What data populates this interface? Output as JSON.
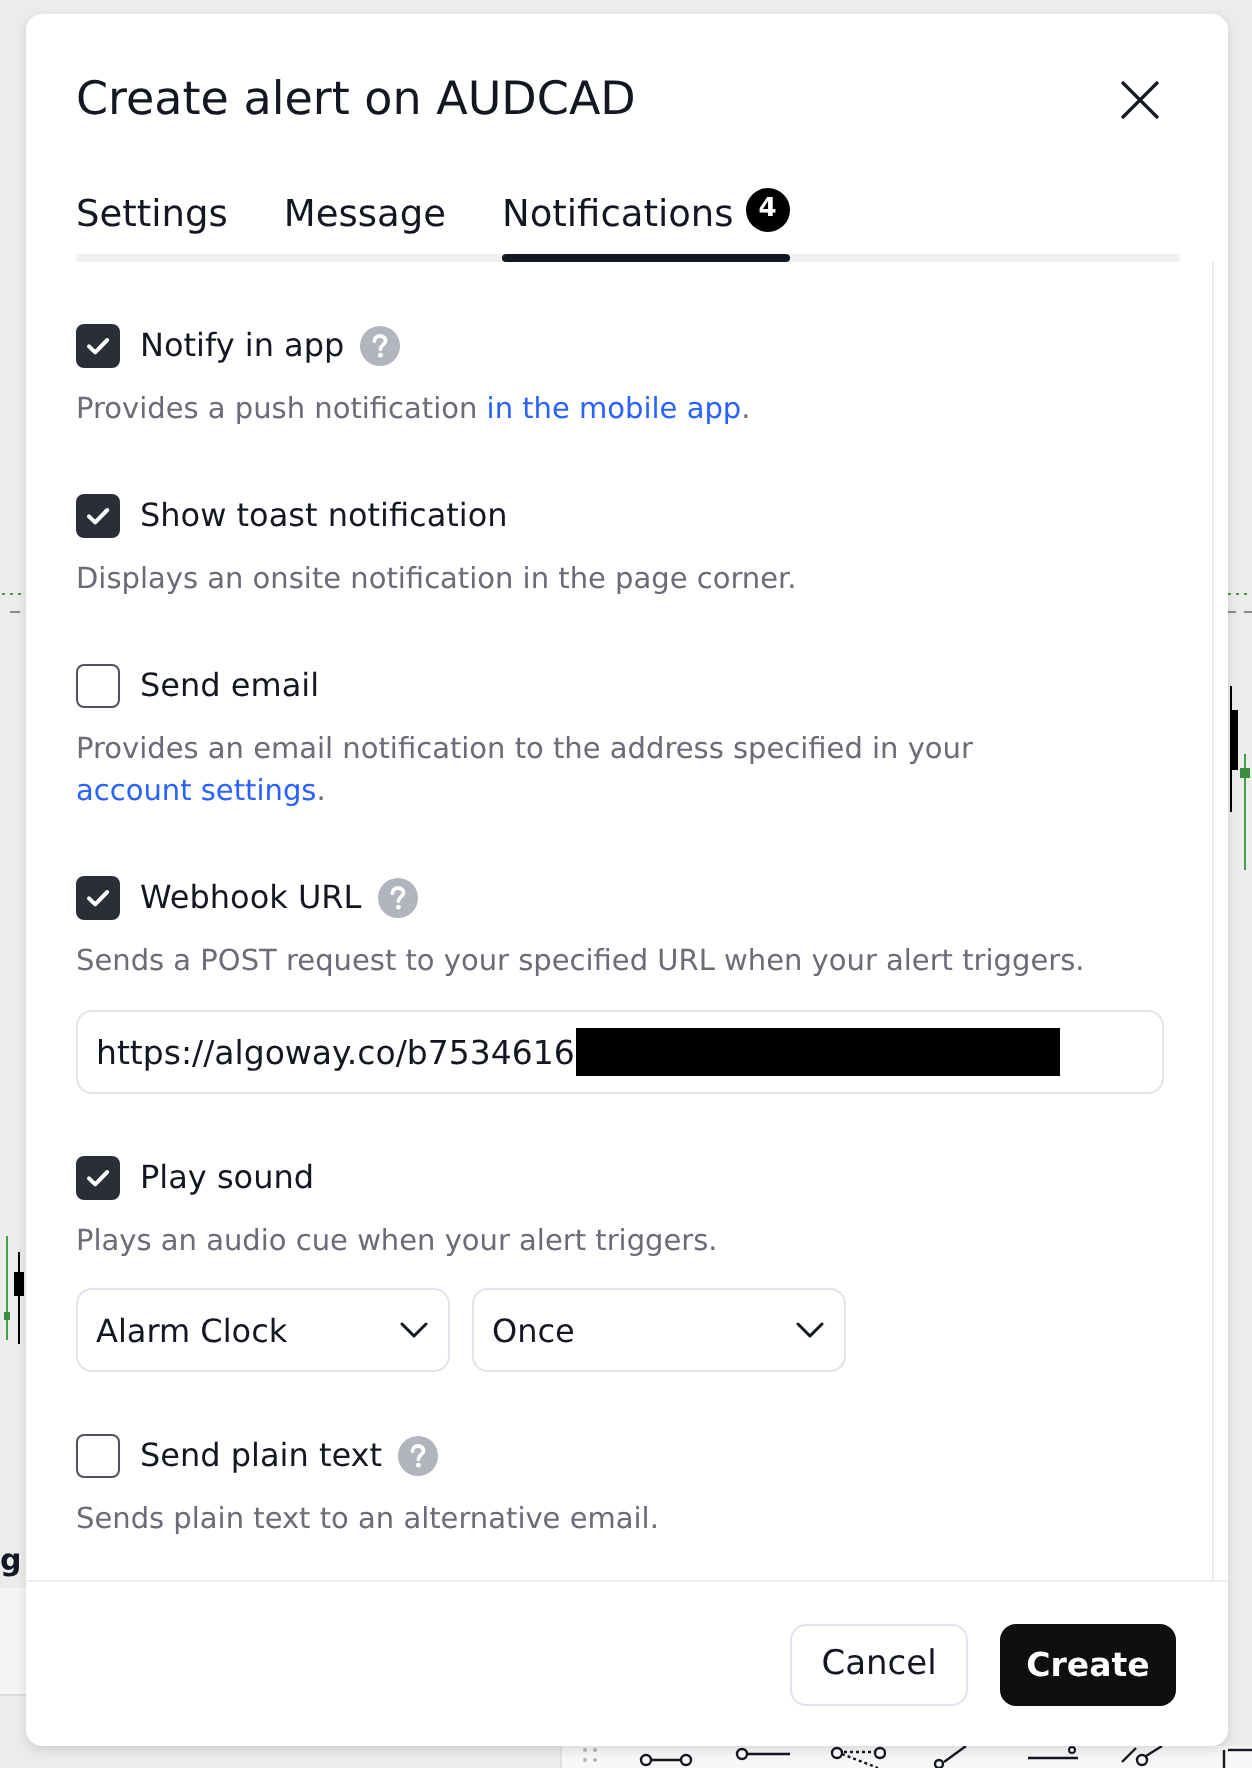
{
  "dialog": {
    "title": "Create alert on AUDCAD"
  },
  "tabs": [
    {
      "label": "Settings",
      "selected": false
    },
    {
      "label": "Message",
      "selected": false
    },
    {
      "label": "Notifications",
      "selected": true,
      "badge": "4"
    }
  ],
  "options": [
    {
      "label": "Notify in app",
      "checked": true,
      "help": true,
      "description": [
        {
          "kind": "text",
          "text": "Provides a push notification "
        },
        {
          "kind": "link",
          "text": "in the mobile app"
        },
        {
          "kind": "text",
          "text": "."
        }
      ]
    },
    {
      "label": "Show toast notification",
      "checked": true,
      "help": false,
      "description": [
        {
          "kind": "text",
          "text": "Displays an onsite notification in the page corner."
        }
      ]
    },
    {
      "label": "Send email",
      "checked": false,
      "help": false,
      "description": [
        {
          "kind": "text",
          "text": "Provides an email notification to the address specified in your "
        },
        {
          "kind": "link",
          "text": "account settings"
        },
        {
          "kind": "text",
          "text": "."
        }
      ]
    },
    {
      "label": "Webhook URL",
      "checked": true,
      "help": true,
      "description": [
        {
          "kind": "text",
          "text": "Sends a POST request to your specified URL when your alert triggers."
        }
      ],
      "field": {
        "value": "https://algoway.co/b7534616",
        "redacted": true
      }
    },
    {
      "label": "Play sound",
      "checked": true,
      "help": false,
      "description": [
        {
          "kind": "text",
          "text": "Plays an audio cue when your alert triggers."
        }
      ],
      "selects": [
        {
          "value": "Alarm Clock"
        },
        {
          "value": "Once"
        }
      ]
    },
    {
      "label": "Send plain text",
      "checked": false,
      "help": true,
      "description": [
        {
          "kind": "text",
          "text": "Sends plain text to an alternative email."
        }
      ]
    }
  ],
  "buttons": [
    {
      "label": "Cancel",
      "kind": "secondary"
    },
    {
      "label": "Create",
      "kind": "primary"
    }
  ],
  "background": {
    "cut_label": "g"
  }
}
